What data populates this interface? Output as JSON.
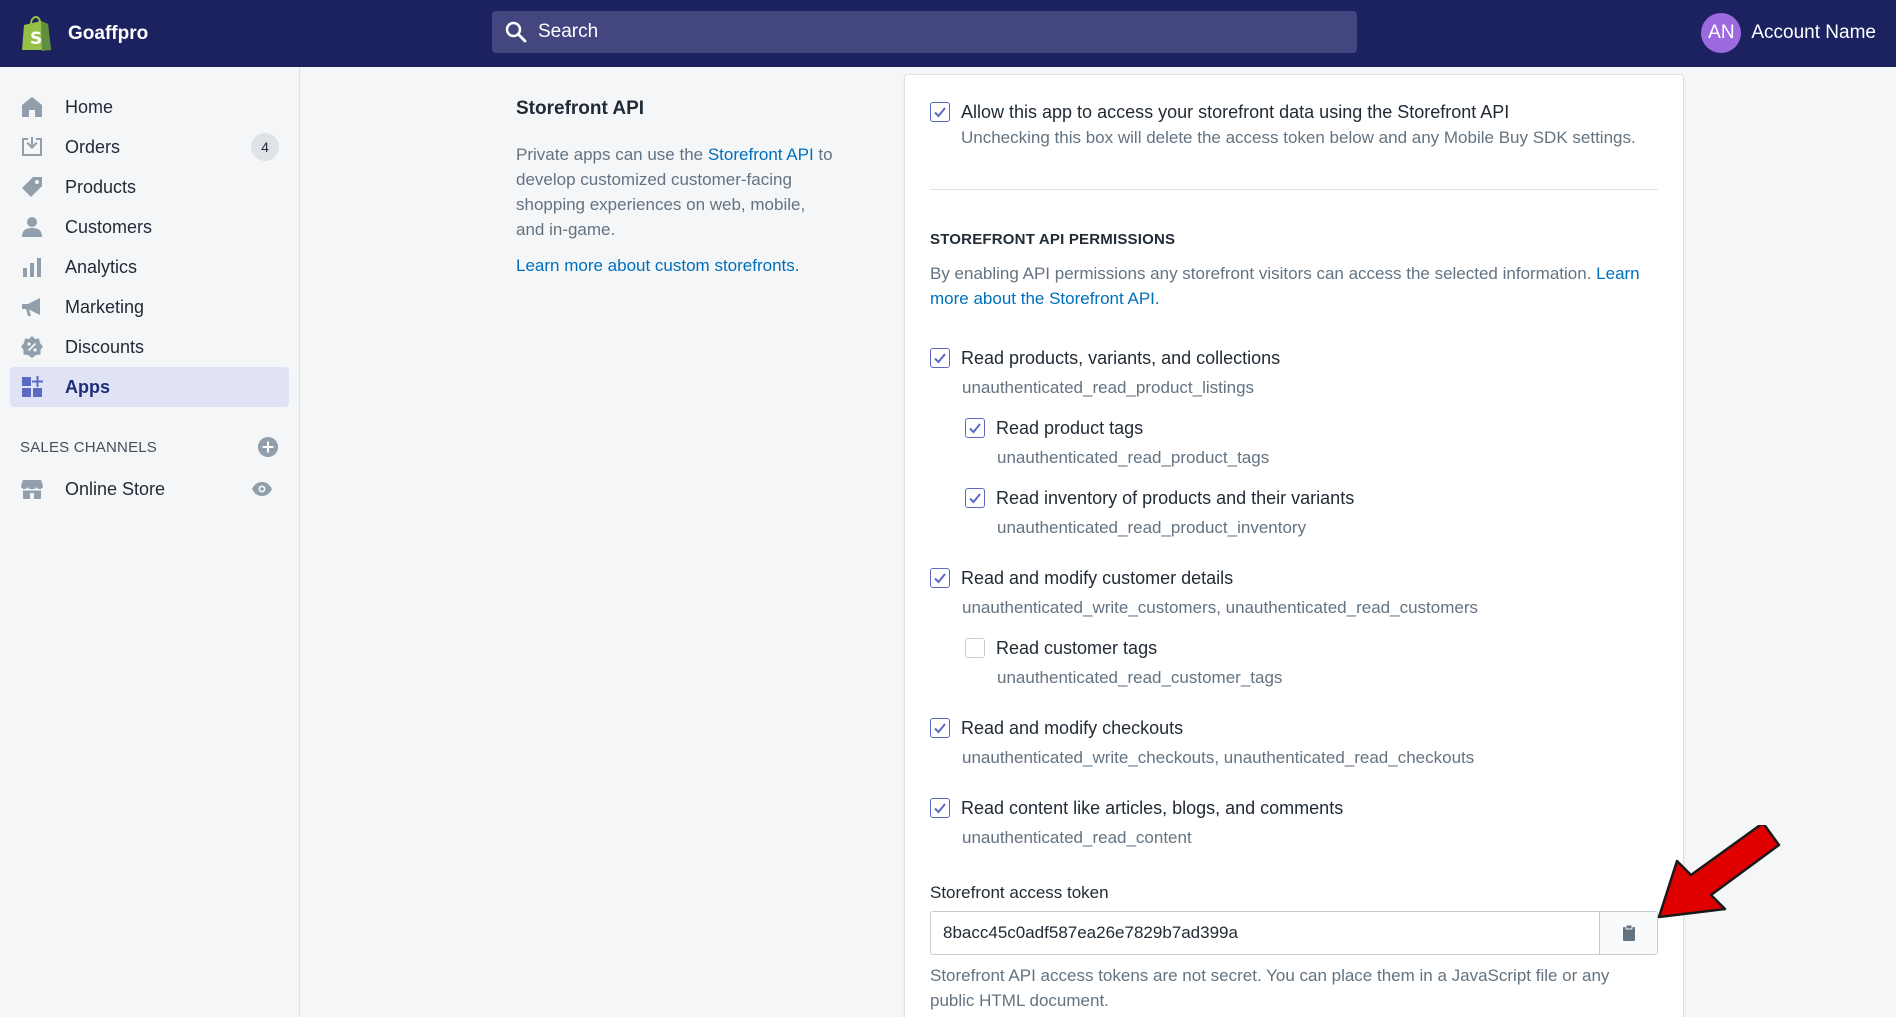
{
  "topbar": {
    "brand_name": "Goaffpro",
    "search_placeholder": "Search",
    "avatar_initials": "AN",
    "account_name": "Account Name"
  },
  "sidebar": {
    "items": [
      {
        "label": "Home",
        "icon": "home-icon"
      },
      {
        "label": "Orders",
        "icon": "orders-icon",
        "badge": "4"
      },
      {
        "label": "Products",
        "icon": "tag-icon"
      },
      {
        "label": "Customers",
        "icon": "person-icon"
      },
      {
        "label": "Analytics",
        "icon": "bar-chart-icon"
      },
      {
        "label": "Marketing",
        "icon": "megaphone-icon"
      },
      {
        "label": "Discounts",
        "icon": "discount-icon"
      },
      {
        "label": "Apps",
        "icon": "apps-icon",
        "active": true
      }
    ],
    "sales_channels_heading": "SALES CHANNELS",
    "online_store_label": "Online Store"
  },
  "description": {
    "title": "Storefront API",
    "body_prefix": "Private apps can use the ",
    "body_link": "Storefront API",
    "body_suffix": " to develop customized customer-facing shopping experiences on web, mobile, and in-game.",
    "learn_more": "Learn more about custom storefronts."
  },
  "card": {
    "allow": {
      "label": "Allow this app to access your storefront data using the Storefront API",
      "help": "Unchecking this box will delete the access token below and any Mobile Buy SDK settings.",
      "checked": true
    },
    "permissions_heading": "STOREFRONT API PERMISSIONS",
    "permissions_desc": "By enabling API permissions any storefront visitors can access the selected information. ",
    "permissions_link": "Learn more about the Storefront API.",
    "permissions": [
      {
        "label": "Read products, variants, and collections",
        "scope": "unauthenticated_read_product_listings",
        "checked": true
      },
      {
        "label": "Read product tags",
        "scope": "unauthenticated_read_product_tags",
        "checked": true
      },
      {
        "label": "Read inventory of products and their variants",
        "scope": "unauthenticated_read_product_inventory",
        "checked": true
      },
      {
        "label": "Read and modify customer details",
        "scope": "unauthenticated_write_customers, unauthenticated_read_customers",
        "checked": true
      },
      {
        "label": "Read customer tags",
        "scope": "unauthenticated_read_customer_tags",
        "checked": false
      },
      {
        "label": "Read and modify checkouts",
        "scope": "unauthenticated_write_checkouts, unauthenticated_read_checkouts",
        "checked": true
      },
      {
        "label": "Read content like articles, blogs, and comments",
        "scope": "unauthenticated_read_content",
        "checked": true
      }
    ],
    "token_label": "Storefront access token",
    "token_value": "8bacc45c0adf587ea26e7829b7ad399a",
    "token_help": "Storefront API access tokens are not secret. You can place them in a JavaScript file or any public HTML document."
  },
  "colors": {
    "topbar": "#1c2260",
    "accent": "#5c6ac4",
    "link": "#006fbb",
    "annotation_arrow": "#e00000"
  }
}
